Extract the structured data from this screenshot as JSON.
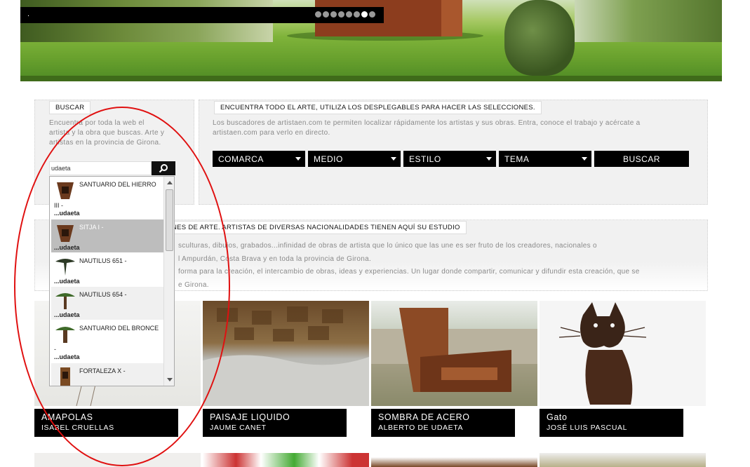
{
  "hero": {
    "caption": ".",
    "dots_total": 8,
    "dots_active_index": 6
  },
  "search_panel": {
    "title": "BUSCAR",
    "description_lines": [
      "Encuentra por toda la web el",
      "artista y la obra que buscas. Arte y",
      "artistas en la provincia de Girona."
    ],
    "input_value": "udaeta"
  },
  "finder_panel": {
    "title": "ENCUENTRA TODO EL ARTE, UTILIZA LOS DESPLEGABLES PARA HACER LAS SELECCIONES.",
    "description_lines": [
      "Los buscadores de artistaen.com te permiten localizar rápidamente los artistas y sus obras. Entra, conoce el trabajo y acércate a",
      "artistaen.com para verlo en directo."
    ],
    "dropdowns": [
      "COMARCA",
      "MEDIO",
      "ESTILO",
      "TEMA"
    ],
    "search_button": "BUSCAR"
  },
  "info_panel": {
    "title": "NES DE ARTE. ARTISTAS DE DIVERSAS NACIONALIDADES TIENEN AQUÍ SU ESTUDIO",
    "lines": [
      "sculturas, dibujos, grabados...infinidad de obras de artista que lo único que las une es ser fruto de los creadores, nacionales o",
      "l Ampurdán, Costa Brava y en toda la provincia de Girona.",
      "forma para la creación, el intercambio de obras, ideas y experiencias. Un lugar donde compartir, comunicar y difundir esta creación, que se",
      "e Girona."
    ]
  },
  "autocomplete": [
    {
      "name": "SANTUARIO DEL HIERRO",
      "extra": "III -",
      "sub": "...udaeta"
    },
    {
      "name": "SITJA I -",
      "extra": "",
      "sub": "...udaeta"
    },
    {
      "name": "NAUTILUS 651 -",
      "extra": "",
      "sub": "...udaeta"
    },
    {
      "name": "NAUTILUS 654 -",
      "extra": "",
      "sub": "...udaeta"
    },
    {
      "name": "SANTUARIO DEL BRONCE",
      "extra": "-",
      "sub": "...udaeta"
    },
    {
      "name": "FORTALEZA X -",
      "extra": "",
      "sub": ""
    }
  ],
  "gallery": [
    {
      "title": "AMAPOLAS",
      "artist": "ISABEL CRUELLAS"
    },
    {
      "title": "PAISAJE LIQUIDO",
      "artist": "JAUME CANET"
    },
    {
      "title": "SOMBRA DE ACERO",
      "artist": "ALBERTO DE UDAETA"
    },
    {
      "title": "Gato",
      "artist": "JOSÉ LUIS PASCUAL"
    }
  ],
  "colors": {
    "accent_red": "#e01010",
    "bar_black": "#000000",
    "panel_bg": "#f1f1f1"
  }
}
